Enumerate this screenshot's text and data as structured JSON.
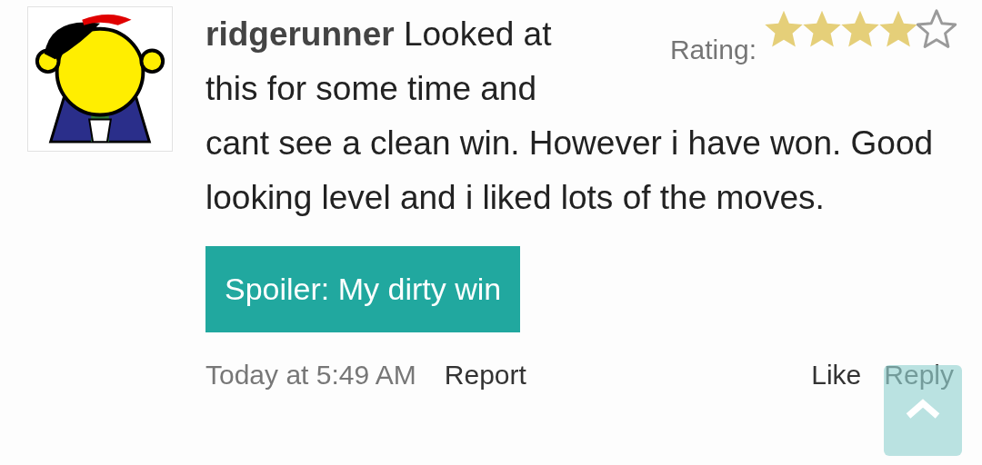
{
  "comment": {
    "author": "ridgerunner",
    "text": [
      "Looked at this for some time and",
      "cant see a clean win. However i have won. Good looking level and i liked lots of the moves."
    ],
    "rating": {
      "label": "Rating:",
      "stars": 4
    },
    "spoiler_button": "Spoiler: My dirty win",
    "timestamp": "Today at 5:49 AM",
    "report": "Report",
    "like": "Like",
    "reply": "Reply"
  }
}
